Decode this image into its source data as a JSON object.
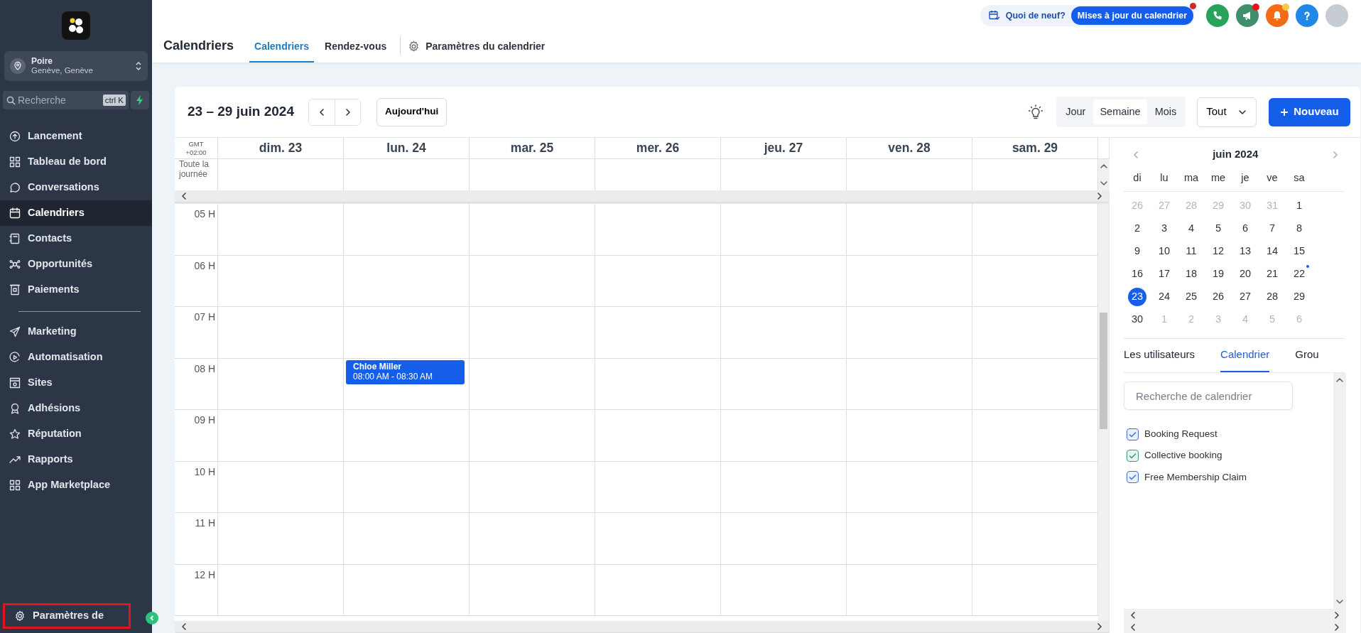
{
  "sidebar": {
    "location": {
      "name": "Poire",
      "address": "Genève, Genève"
    },
    "search": {
      "placeholder": "Recherche",
      "shortcut": "ctrl K"
    },
    "nav_groups": [
      [
        {
          "label": "Lancement",
          "selected": false
        },
        {
          "label": "Tableau de bord",
          "selected": false
        },
        {
          "label": "Conversations",
          "selected": false
        },
        {
          "label": "Calendriers",
          "selected": true
        },
        {
          "label": "Contacts",
          "selected": false
        },
        {
          "label": "Opportunités",
          "selected": false
        },
        {
          "label": "Paiements",
          "selected": false
        }
      ],
      [
        {
          "label": "Marketing",
          "selected": false
        },
        {
          "label": "Automatisation",
          "selected": false
        },
        {
          "label": "Sites",
          "selected": false
        },
        {
          "label": "Adhésions",
          "selected": false
        },
        {
          "label": "Réputation",
          "selected": false
        },
        {
          "label": "Rapports",
          "selected": false
        },
        {
          "label": "App Marketplace",
          "selected": false
        }
      ]
    ],
    "footer_item": {
      "label": "Paramètres de",
      "highlighted": true
    }
  },
  "header": {
    "title": "Calendriers",
    "tabs": [
      {
        "label": "Calendriers",
        "selected": true
      },
      {
        "label": "Rendez-vous",
        "selected": false
      }
    ],
    "settings_link": "Paramètres du calendrier",
    "whats_new": {
      "label": "Quoi de neuf?",
      "badge": "Mises à jour du calendrier",
      "notification": true
    },
    "action_buttons": [
      {
        "kind": "phone",
        "color": "#27a35a",
        "notification": false
      },
      {
        "kind": "megaphone",
        "color": "#3f8f6d",
        "notification": true
      },
      {
        "kind": "bell",
        "color": "#f36c15",
        "notification": true
      },
      {
        "kind": "help",
        "color": "#2188e8",
        "notification": false
      }
    ]
  },
  "toolbar": {
    "range": "23 – 29 juin 2024",
    "today": "Aujourd'hui",
    "views": [
      {
        "label": "Jour",
        "selected": false
      },
      {
        "label": "Semaine",
        "selected": true
      },
      {
        "label": "Mois",
        "selected": false
      }
    ],
    "filter": "Tout",
    "new_button": "Nouveau"
  },
  "grid": {
    "timezone_label": "GMT",
    "timezone_offset": "+02:00",
    "all_day_label": "Toute la journée",
    "days": [
      {
        "label": "dim. 23"
      },
      {
        "label": "lun. 24",
        "events": [
          {
            "title": "Chloe Miller",
            "time": "08:00 AM - 08:30 AM"
          }
        ]
      },
      {
        "label": "mar. 25"
      },
      {
        "label": "mer. 26"
      },
      {
        "label": "jeu. 27"
      },
      {
        "label": "ven. 28"
      },
      {
        "label": "sam. 29"
      }
    ],
    "hours": [
      "05 H",
      "06 H",
      "07 H",
      "08 H",
      "09 H",
      "10 H",
      "11 H",
      "12 H"
    ]
  },
  "mini_calendar": {
    "month": "juin 2024",
    "weekdays": [
      "di",
      "lu",
      "ma",
      "me",
      "je",
      "ve",
      "sa"
    ],
    "weeks": [
      [
        {
          "label": "26",
          "outside": true,
          "selected": false
        },
        {
          "label": "27",
          "outside": true,
          "selected": false
        },
        {
          "label": "28",
          "outside": true,
          "selected": false
        },
        {
          "label": "29",
          "outside": true,
          "selected": false
        },
        {
          "label": "30",
          "outside": true,
          "selected": false
        },
        {
          "label": "31",
          "outside": true,
          "selected": false
        },
        {
          "label": "1",
          "outside": false,
          "selected": false
        }
      ],
      [
        {
          "label": "2",
          "outside": false,
          "selected": false
        },
        {
          "label": "3",
          "outside": false,
          "selected": false
        },
        {
          "label": "4",
          "outside": false,
          "selected": false
        },
        {
          "label": "5",
          "outside": false,
          "selected": false
        },
        {
          "label": "6",
          "outside": false,
          "selected": false
        },
        {
          "label": "7",
          "outside": false,
          "selected": false
        },
        {
          "label": "8",
          "outside": false,
          "selected": false
        }
      ],
      [
        {
          "label": "9",
          "outside": false,
          "selected": false
        },
        {
          "label": "10",
          "outside": false,
          "selected": false
        },
        {
          "label": "11",
          "outside": false,
          "selected": false
        },
        {
          "label": "12",
          "outside": false,
          "selected": false
        },
        {
          "label": "13",
          "outside": false,
          "selected": false
        },
        {
          "label": "14",
          "outside": false,
          "selected": false
        },
        {
          "label": "15",
          "outside": false,
          "selected": false
        }
      ],
      [
        {
          "label": "16",
          "outside": false,
          "selected": false
        },
        {
          "label": "17",
          "outside": false,
          "selected": false
        },
        {
          "label": "18",
          "outside": false,
          "selected": false
        },
        {
          "label": "19",
          "outside": false,
          "selected": false
        },
        {
          "label": "20",
          "outside": false,
          "selected": false
        },
        {
          "label": "21",
          "outside": false,
          "selected": false
        },
        {
          "label": "22",
          "outside": false,
          "selected": false,
          "has_event": true
        }
      ],
      [
        {
          "label": "23",
          "outside": false,
          "selected": true
        },
        {
          "label": "24",
          "outside": false,
          "selected": false
        },
        {
          "label": "25",
          "outside": false,
          "selected": false
        },
        {
          "label": "26",
          "outside": false,
          "selected": false
        },
        {
          "label": "27",
          "outside": false,
          "selected": false
        },
        {
          "label": "28",
          "outside": false,
          "selected": false
        },
        {
          "label": "29",
          "outside": false,
          "selected": false
        }
      ],
      [
        {
          "label": "30",
          "outside": false,
          "selected": false
        },
        {
          "label": "1",
          "outside": true,
          "selected": false
        },
        {
          "label": "2",
          "outside": true,
          "selected": false
        },
        {
          "label": "3",
          "outside": true,
          "selected": false
        },
        {
          "label": "4",
          "outside": true,
          "selected": false
        },
        {
          "label": "5",
          "outside": true,
          "selected": false
        },
        {
          "label": "6",
          "outside": true,
          "selected": false
        }
      ]
    ]
  },
  "panel": {
    "tabs": [
      {
        "label": "Les utilisateurs",
        "selected": false
      },
      {
        "label": "Calendrier",
        "selected": true
      },
      {
        "label": "Grou",
        "selected": false
      }
    ],
    "search": {
      "placeholder": "Recherche de calendrier"
    },
    "calendars": [
      {
        "label": "Booking Request",
        "checked": true,
        "color": "#3b6fd4"
      },
      {
        "label": "Collective booking",
        "checked": true,
        "color": "#2f9e6e"
      },
      {
        "label": "Free Membership Claim",
        "checked": true,
        "color": "#3b6fd4"
      }
    ]
  }
}
